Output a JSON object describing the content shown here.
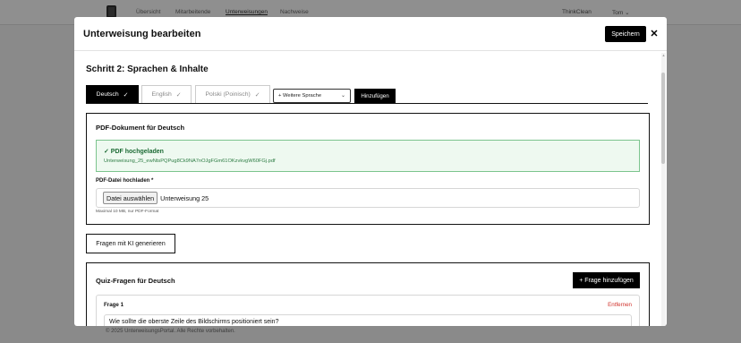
{
  "background": {
    "nav_links": [
      "Übersicht",
      "Mitarbeitende",
      "Unterweisungen",
      "Nachweise"
    ],
    "active_nav": "Unterweisungen",
    "company": "ThinkClean",
    "user": "Tom",
    "footer": "© 2025 UnterweisungsPortal. Alle Rechte vorbehalten."
  },
  "modal": {
    "title": "Unterweisung bearbeiten",
    "save_label": "Speichern",
    "close_glyph": "✕",
    "step_title": "Schritt 2: Sprachen & Inhalte",
    "tabs": [
      {
        "label": "Deutsch",
        "check": "✓",
        "active": true
      },
      {
        "label": "English",
        "check": "✓",
        "active": false
      },
      {
        "label": "Polski (Poinisch)",
        "check": "✓",
        "active": false
      }
    ],
    "language_select": {
      "value": "+ Weitere Sprache",
      "chevron": "⌄"
    },
    "add_language_label": "Hinzufügen"
  },
  "pdf_section": {
    "title": "PDF-Dokument für Deutsch",
    "upload_success_title": "✓ PDF hochgeladen",
    "upload_success_file": "Unterweisung_25_ewNtsPQPug8Ck9NA7nOJgFGm61OKzvkvgW60FGj.pdf",
    "field_label": "PDF-Datei hochladen *",
    "file_button": "Datei auswählen",
    "file_name": "Unterweisung 25",
    "hint": "Maximal 10 MB, nur PDF-Format"
  },
  "ki_button": "Fragen mit KI generieren",
  "quiz_section": {
    "title": "Quiz-Fragen für Deutsch",
    "add_question_label": "+ Frage hinzufügen",
    "questions": [
      {
        "label": "Frage 1",
        "remove_label": "Entfernen",
        "text": "Wie sollte die oberste Zeile des Bildschirms positioniert sein?"
      }
    ]
  },
  "colors": {
    "primary": "#000000",
    "success_bg": "#eef9f0",
    "success_border": "#7cc48e",
    "danger": "#d0302a"
  }
}
